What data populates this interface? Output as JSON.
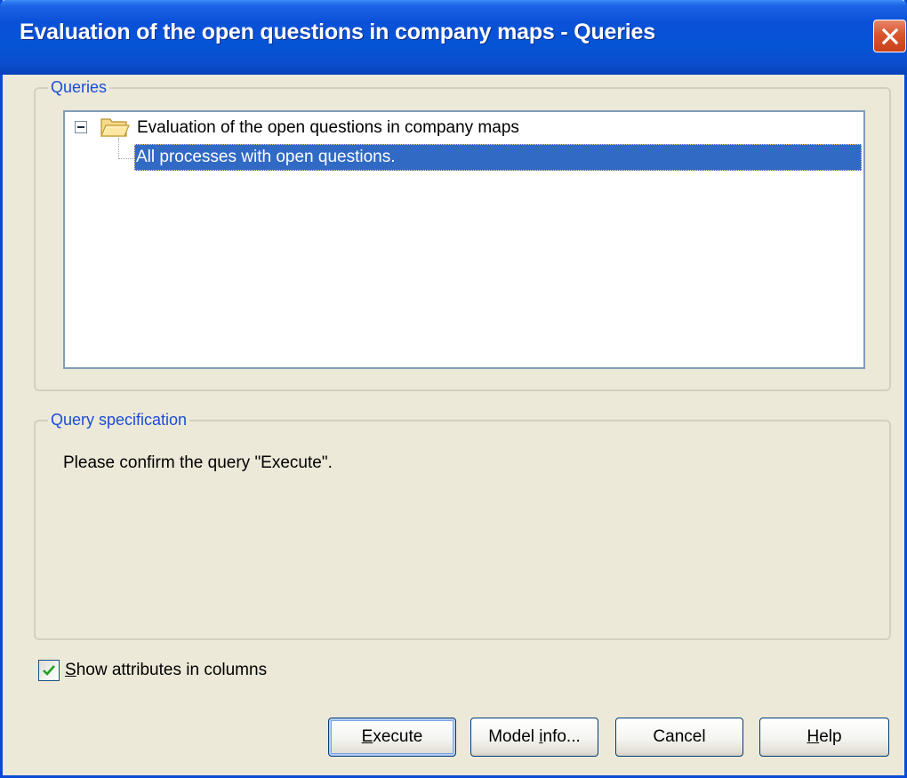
{
  "window": {
    "title": "Evaluation of the open questions in company maps - Queries",
    "close_icon": "close-icon"
  },
  "queries_group": {
    "legend": "Queries",
    "tree": {
      "root": {
        "label": "Evaluation of the open questions in company maps",
        "expanded": true,
        "icon": "folder-open-icon"
      },
      "children": [
        {
          "label": "All processes with open questions.",
          "selected": true
        }
      ]
    }
  },
  "spec_group": {
    "legend": "Query specification",
    "text": "Please confirm the query \"Execute\"."
  },
  "options": {
    "show_attributes": {
      "checked": true,
      "mnemonic": "S",
      "rest": "how attributes in columns"
    }
  },
  "buttons": {
    "execute": {
      "mnemonic": "E",
      "rest": "xecute",
      "default": true
    },
    "model_info": {
      "pre": "Model ",
      "mnemonic": "i",
      "rest": "nfo..."
    },
    "cancel": {
      "label": "Cancel"
    },
    "help": {
      "mnemonic": "H",
      "rest": "elp"
    }
  },
  "colors": {
    "title_bar": "#0a51d8",
    "dialog_bg": "#ece9d8",
    "selection": "#316ac5",
    "group_legend": "#1c4dd8",
    "close_button": "#d8552d"
  }
}
